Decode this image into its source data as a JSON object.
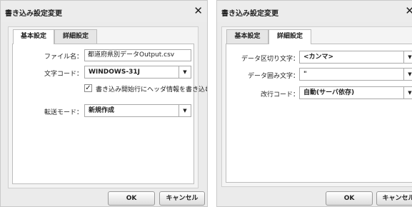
{
  "left_dialog": {
    "title": "書き込み設定変更",
    "close_icon": "✕",
    "tabs": [
      "基本設定",
      "詳細設定"
    ],
    "active_tab": "基本設定",
    "filename_label": "ファイル名：",
    "filename_value": "都道府県別データOutput.csv",
    "charcode_label": "文字コード：",
    "charcode_value": "WINDOWS-31J",
    "header_checkbox_label": "書き込み開始行にヘッダ情報を書き込む",
    "header_checkbox_checked": true,
    "transfer_mode_label": "転送モード：",
    "transfer_mode_value": "新規作成",
    "ok_label": "OK",
    "cancel_label": "キャンセル"
  },
  "right_dialog": {
    "title": "書き込み設定変更",
    "close_icon": "✕",
    "tabs": [
      "基本設定",
      "詳細設定"
    ],
    "active_tab": "詳細設定",
    "delimiter_label": "データ区切り文字：",
    "delimiter_value": "<カンマ>",
    "quote_label": "データ囲み文字：",
    "quote_value": "\"",
    "newline_label": "改行コード：",
    "newline_value": "自動(サーバ依存)",
    "ok_label": "OK",
    "cancel_label": "キャンセル"
  },
  "icons": {
    "close": "close-icon",
    "dropdown": "chevron-down-icon",
    "check": "check-icon"
  }
}
